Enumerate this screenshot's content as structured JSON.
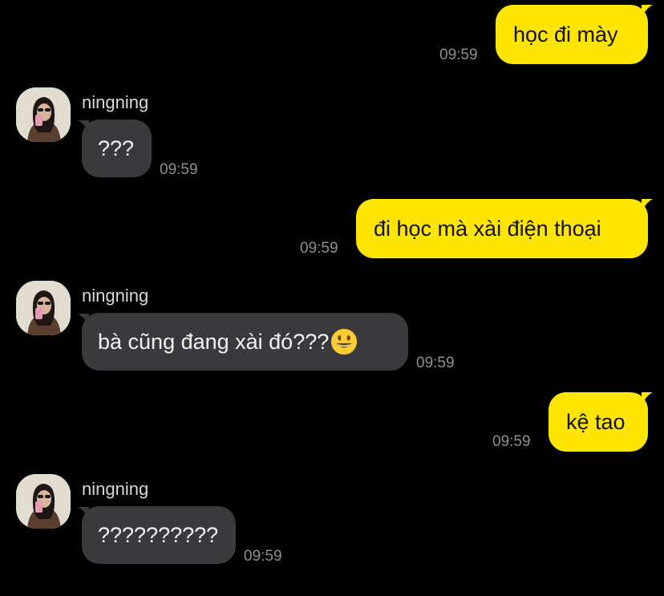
{
  "theme": {
    "background": "#000000",
    "outgoing_bubble": "#FEE500",
    "incoming_bubble": "#3A3A3C",
    "timestamp_color": "#8E8E93"
  },
  "messages": [
    {
      "direction": "outgoing",
      "text": "học đi mày",
      "time": "09:59"
    },
    {
      "direction": "incoming",
      "sender": "ningning",
      "avatar_icon": "profile-photo-avatar",
      "text": "???",
      "time": "09:59"
    },
    {
      "direction": "outgoing",
      "text": "đi học mà xài điện thoại",
      "time": "09:59"
    },
    {
      "direction": "incoming",
      "sender": "ningning",
      "avatar_icon": "profile-photo-avatar",
      "text": "bà cũng đang xài đó???",
      "emoji": "smiling-face-emoji",
      "time": "09:59"
    },
    {
      "direction": "outgoing",
      "text": "kệ tao",
      "time": "09:59"
    },
    {
      "direction": "incoming",
      "sender": "ningning",
      "avatar_icon": "profile-photo-avatar",
      "text": "??????????",
      "time": "09:59"
    }
  ]
}
